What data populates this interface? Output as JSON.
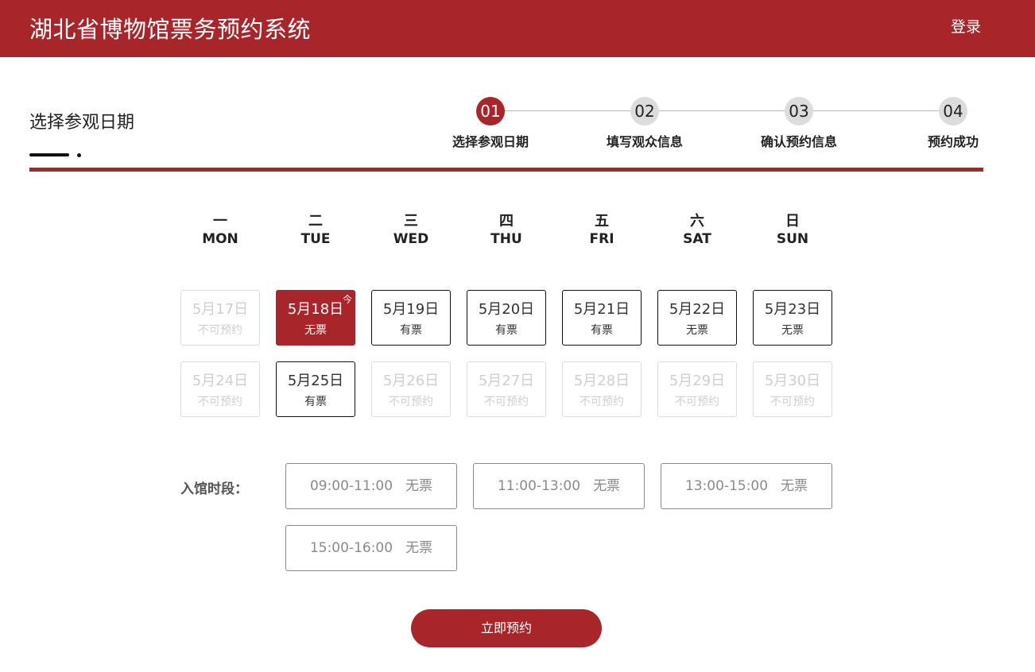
{
  "header": {
    "title": "湖北省博物馆票务预约系统",
    "login_label": "登录"
  },
  "section": {
    "title": "选择参观日期"
  },
  "steps": [
    {
      "num": "01",
      "label": "选择参观日期",
      "active": true
    },
    {
      "num": "02",
      "label": "填写观众信息",
      "active": false
    },
    {
      "num": "03",
      "label": "确认预约信息",
      "active": false
    },
    {
      "num": "04",
      "label": "预约成功",
      "active": false
    }
  ],
  "weekdays": [
    {
      "cn": "一",
      "en": "MON"
    },
    {
      "cn": "二",
      "en": "TUE"
    },
    {
      "cn": "三",
      "en": "WED"
    },
    {
      "cn": "四",
      "en": "THU"
    },
    {
      "cn": "五",
      "en": "FRI"
    },
    {
      "cn": "六",
      "en": "SAT"
    },
    {
      "cn": "日",
      "en": "SUN"
    }
  ],
  "calendar": {
    "today_mark": "今",
    "weeks": [
      [
        {
          "date": "5月17日",
          "status": "不可预约",
          "state": "disabled"
        },
        {
          "date": "5月18日",
          "status": "无票",
          "state": "selected"
        },
        {
          "date": "5月19日",
          "status": "有票",
          "state": "available"
        },
        {
          "date": "5月20日",
          "status": "有票",
          "state": "available"
        },
        {
          "date": "5月21日",
          "status": "有票",
          "state": "available"
        },
        {
          "date": "5月22日",
          "status": "无票",
          "state": "available"
        },
        {
          "date": "5月23日",
          "status": "无票",
          "state": "available"
        }
      ],
      [
        {
          "date": "5月24日",
          "status": "不可预约",
          "state": "disabled"
        },
        {
          "date": "5月25日",
          "status": "有票",
          "state": "available"
        },
        {
          "date": "5月26日",
          "status": "不可预约",
          "state": "disabled"
        },
        {
          "date": "5月27日",
          "status": "不可预约",
          "state": "disabled"
        },
        {
          "date": "5月28日",
          "status": "不可预约",
          "state": "disabled"
        },
        {
          "date": "5月29日",
          "status": "不可预约",
          "state": "disabled"
        },
        {
          "date": "5月30日",
          "status": "不可预约",
          "state": "disabled"
        }
      ]
    ]
  },
  "time_slots": {
    "label": "入馆时段：",
    "slots": [
      {
        "time": "09:00-11:00",
        "status": "无票"
      },
      {
        "time": "11:00-13:00",
        "status": "无票"
      },
      {
        "time": "13:00-15:00",
        "status": "无票"
      },
      {
        "time": "15:00-16:00",
        "status": "无票"
      }
    ]
  },
  "submit_label": "立即预约",
  "colors": {
    "brand": "#a8262a",
    "disabled": "#cfcfcf"
  }
}
